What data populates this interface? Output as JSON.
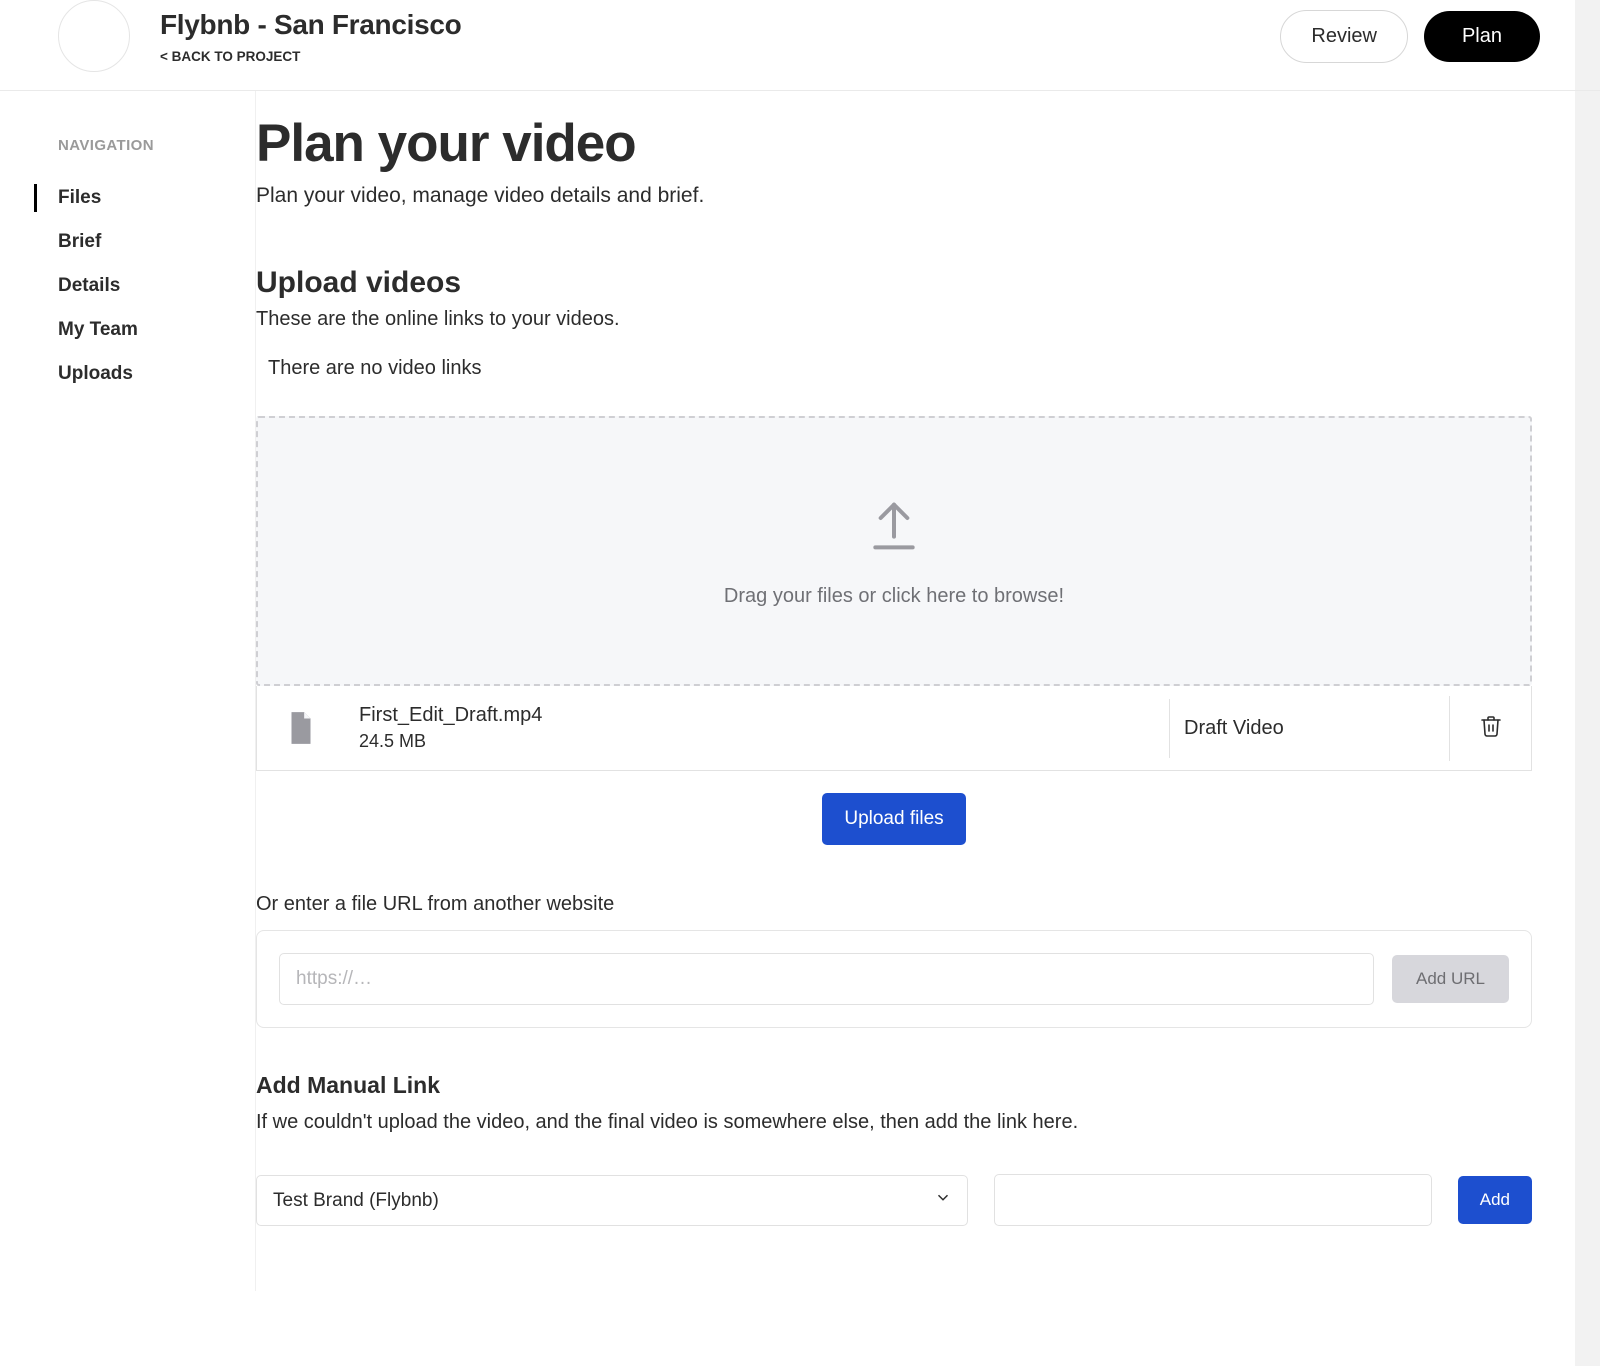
{
  "header": {
    "title": "Flybnb - San Francisco",
    "back_label": "< BACK TO PROJECT",
    "review_btn": "Review",
    "plan_btn": "Plan"
  },
  "sidebar": {
    "heading": "NAVIGATION",
    "items": [
      {
        "label": "Files",
        "active": true
      },
      {
        "label": "Brief",
        "active": false
      },
      {
        "label": "Details",
        "active": false
      },
      {
        "label": "My Team",
        "active": false
      },
      {
        "label": "Uploads",
        "active": false
      }
    ]
  },
  "page": {
    "title": "Plan your video",
    "subtitle": "Plan your video, manage video details and brief."
  },
  "upload": {
    "title": "Upload videos",
    "subtitle": "These are the online links to your videos.",
    "empty_message": "There are no video links",
    "dropzone_text": "Drag your files or click here to browse!",
    "files": [
      {
        "name": "First_Edit_Draft.mp4",
        "size": "24.5 MB",
        "type": "Draft Video"
      }
    ],
    "upload_btn": "Upload files"
  },
  "url_section": {
    "label": "Or enter a file URL from another website",
    "placeholder": "https://…",
    "add_btn": "Add URL"
  },
  "manual": {
    "title": "Add Manual Link",
    "subtitle": "If we couldn't upload the video, and the final video is somewhere else, then add the link here.",
    "brand_selected": "Test Brand (Flybnb)",
    "add_btn": "Add"
  }
}
